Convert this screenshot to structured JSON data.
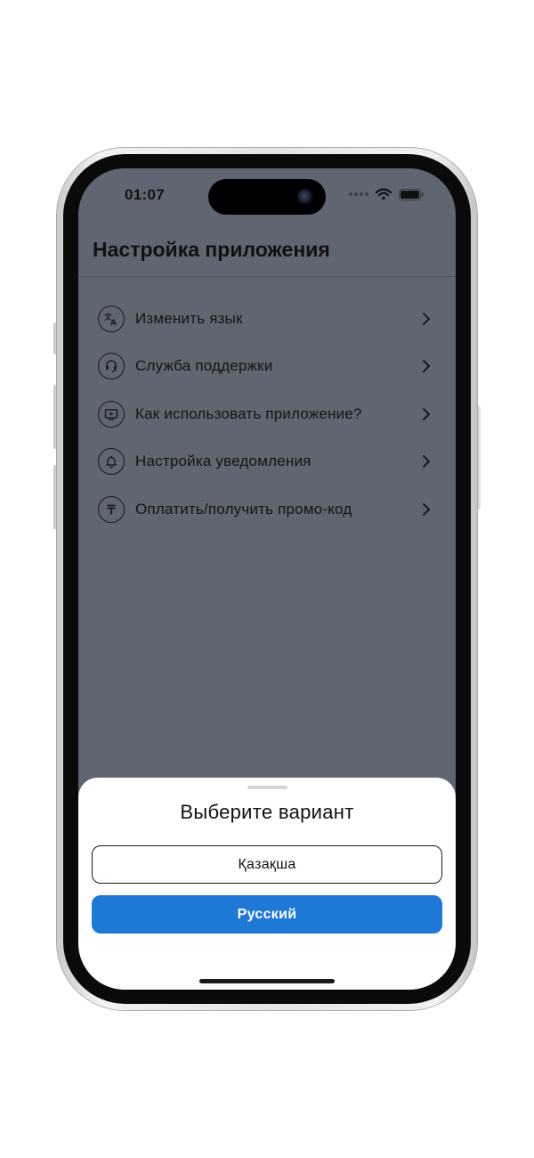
{
  "status_bar": {
    "time": "01:07",
    "icons": [
      "signal-dots-icon",
      "wifi-icon",
      "battery-icon"
    ]
  },
  "header": {
    "title": "Настройка приложения"
  },
  "menu": {
    "items": [
      {
        "label": "Изменить язык",
        "icon": "translate-icon"
      },
      {
        "label": "Служба поддержки",
        "icon": "support-icon"
      },
      {
        "label": "Как использовать приложение?",
        "icon": "video-play-icon"
      },
      {
        "label": "Настройка уведомления",
        "icon": "bell-icon"
      },
      {
        "label": "Оплатить/получить промо-код",
        "icon": "tenge-icon"
      }
    ]
  },
  "sheet": {
    "title": "Выберите вариант",
    "options": [
      {
        "label": "Қазақша",
        "selected": false
      },
      {
        "label": "Русский",
        "selected": true
      }
    ]
  },
  "colors": {
    "overlay_background": "#5f6672",
    "primary_button": "#1e78d6",
    "sheet_background": "#ffffff"
  }
}
